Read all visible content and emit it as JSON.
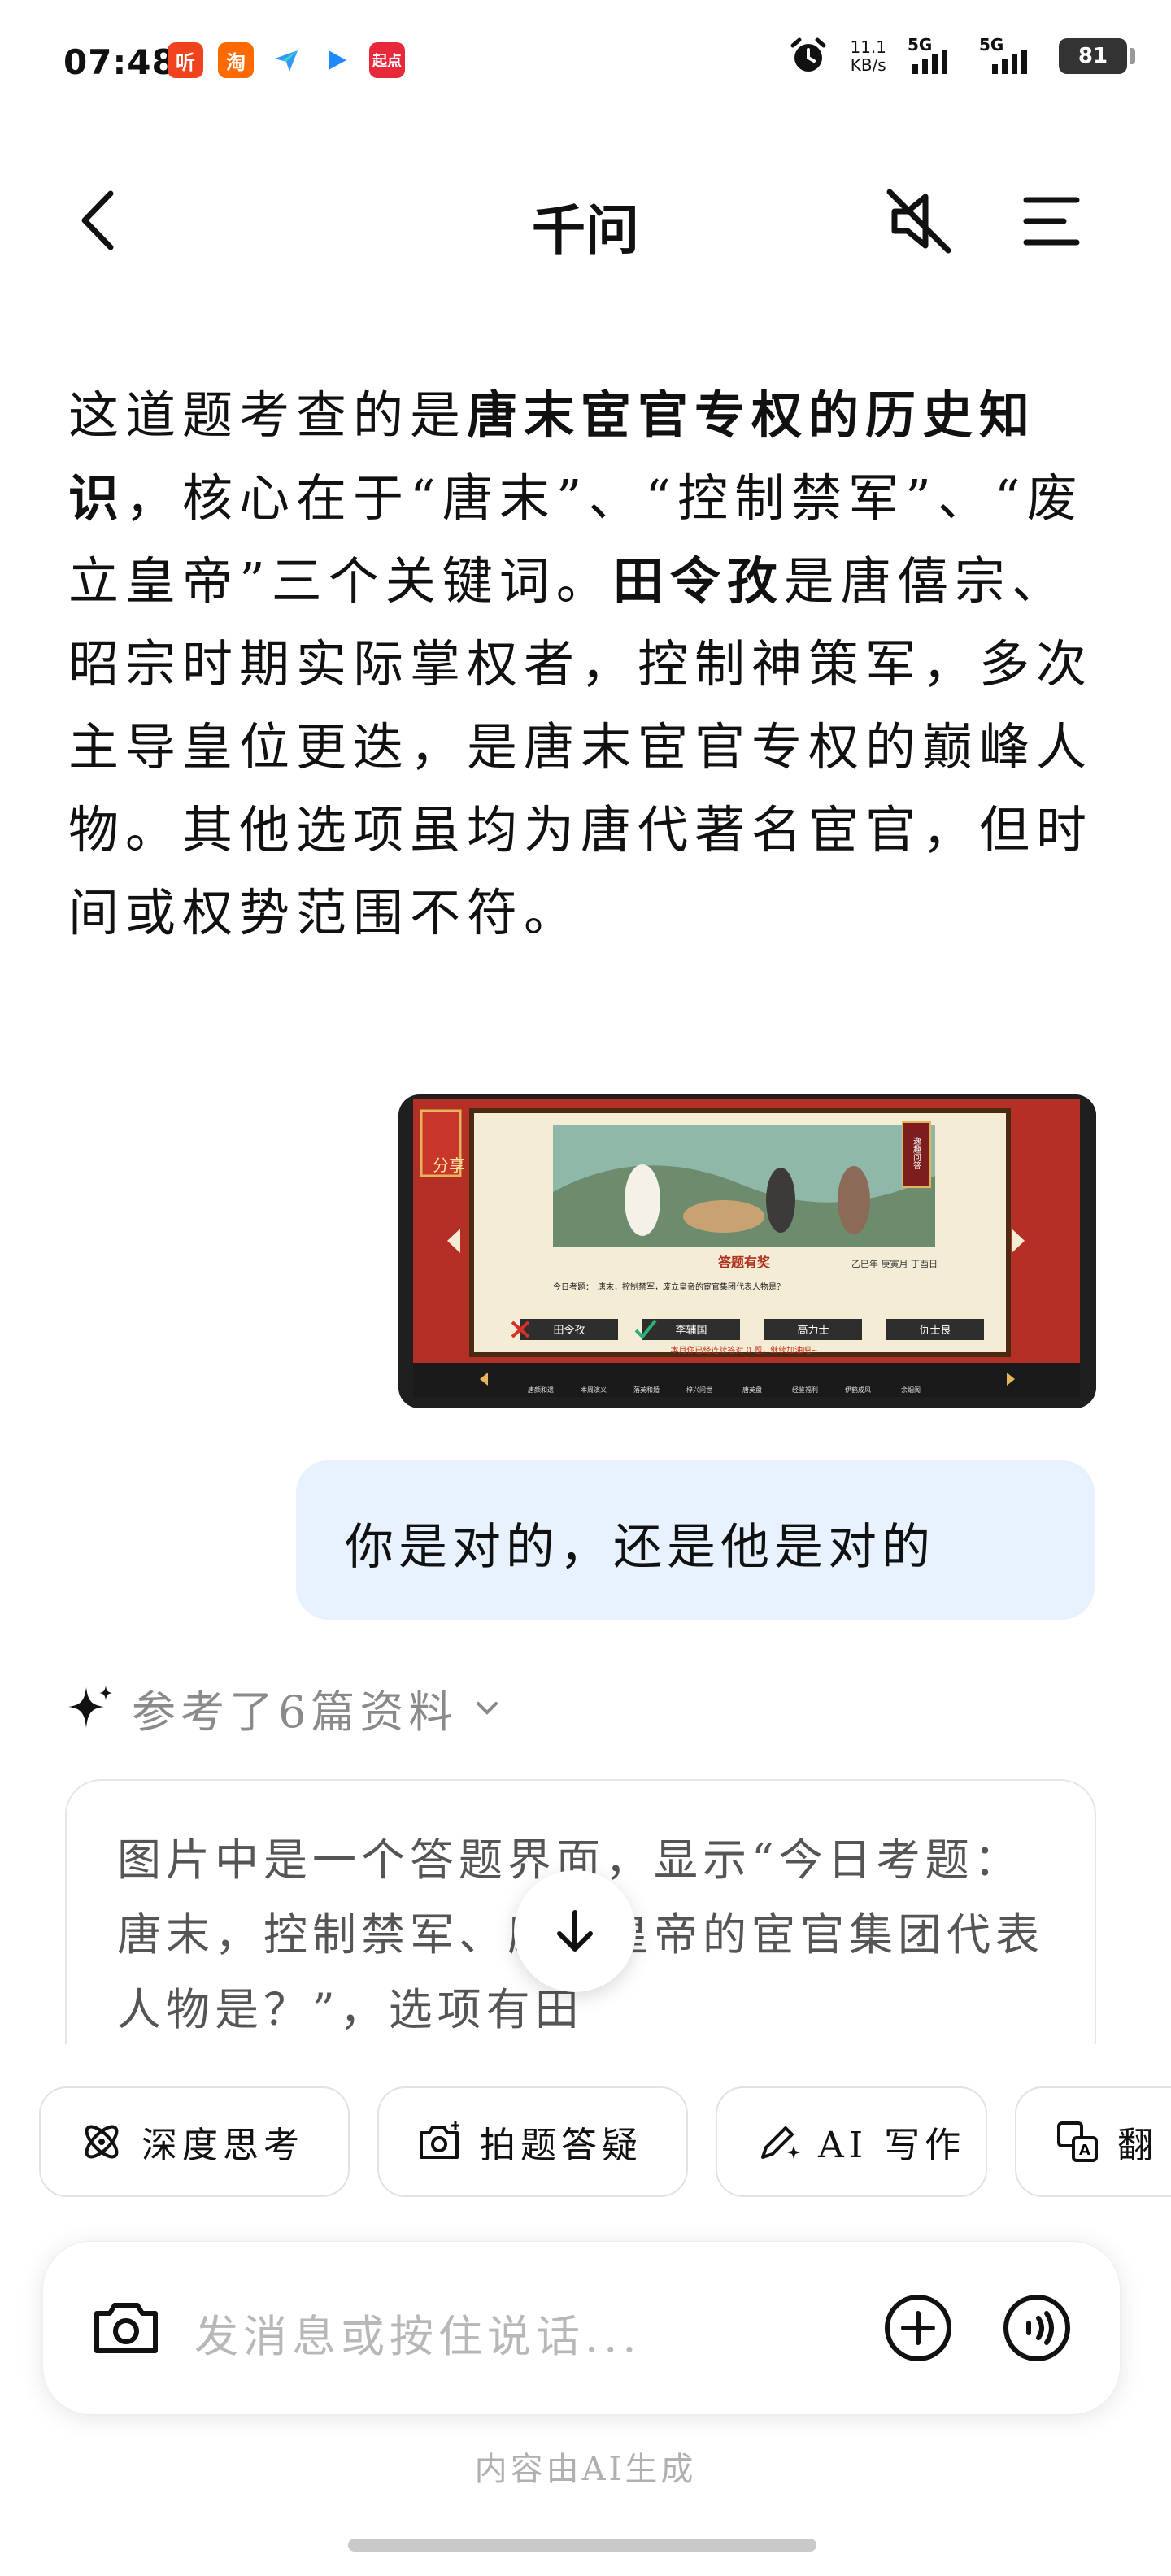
{
  "status_bar": {
    "time": "07:48",
    "apps": [
      {
        "label": "听",
        "color": "#f0421c"
      },
      {
        "label": "淘",
        "color": "#ff6a00"
      },
      {
        "label": "",
        "color": "#2f9bff"
      },
      {
        "label": "",
        "color": "#1e88ff"
      },
      {
        "label": "起点",
        "color": "#e8293b"
      }
    ],
    "net_speed_value": "11.1",
    "net_speed_unit": "KB/s",
    "sim1": "5G",
    "sim2": "5G",
    "battery": "81"
  },
  "header": {
    "title": "千问"
  },
  "conversation": {
    "answer_segments": [
      {
        "text": "这道题考查的是",
        "bold": false
      },
      {
        "text": "唐末宦官专权的历史知识",
        "bold": true
      },
      {
        "text": "，核心在于“唐末”、“控制禁军”、“废立皇帝”三个关键词。",
        "bold": false
      },
      {
        "text": "田令孜",
        "bold": true
      },
      {
        "text": "是唐僖宗、昭宗时期实际掌权者，控制神策军，多次主导皇位更迭，是唐末宦官专权的巅峰人物。其他选项虽均为唐代著名宦官，但时间或权势范围不符。",
        "bold": false
      }
    ],
    "shared_image": {
      "share_label": "分享",
      "banner": "答题有奖",
      "date": "乙巳年 庚寅月 丁酉日",
      "question": "今日考题：　唐末，控制禁军，废立皇帝的宦官集团代表人物是？",
      "options": [
        "田令孜",
        "李辅国",
        "高力士",
        "仇士良"
      ],
      "footer": "本月你已经连续答对 0 题，继续加油吧~",
      "side_label": "逸趣问答",
      "nav_items": [
        "唐颜和遗",
        "本周演义",
        "落英和婚",
        "梓兴问世",
        "唐英盘",
        "经鉴福利",
        "伊鹤成风",
        "余烟阁"
      ]
    },
    "user_message": "你是对的，还是他是对的",
    "references_label": "参考了6篇资料",
    "answer_card_text": "图片中是一个答题界面，显示“今日考题：唐末，控制禁军、废立皇帝的宦官集团代表人物是？”，选项有田"
  },
  "chips": [
    "深度思考",
    "拍题答疑",
    "AI 写作",
    "翻"
  ],
  "input": {
    "placeholder": "发消息或按住说话..."
  },
  "footer_note": "内容由AI生成"
}
